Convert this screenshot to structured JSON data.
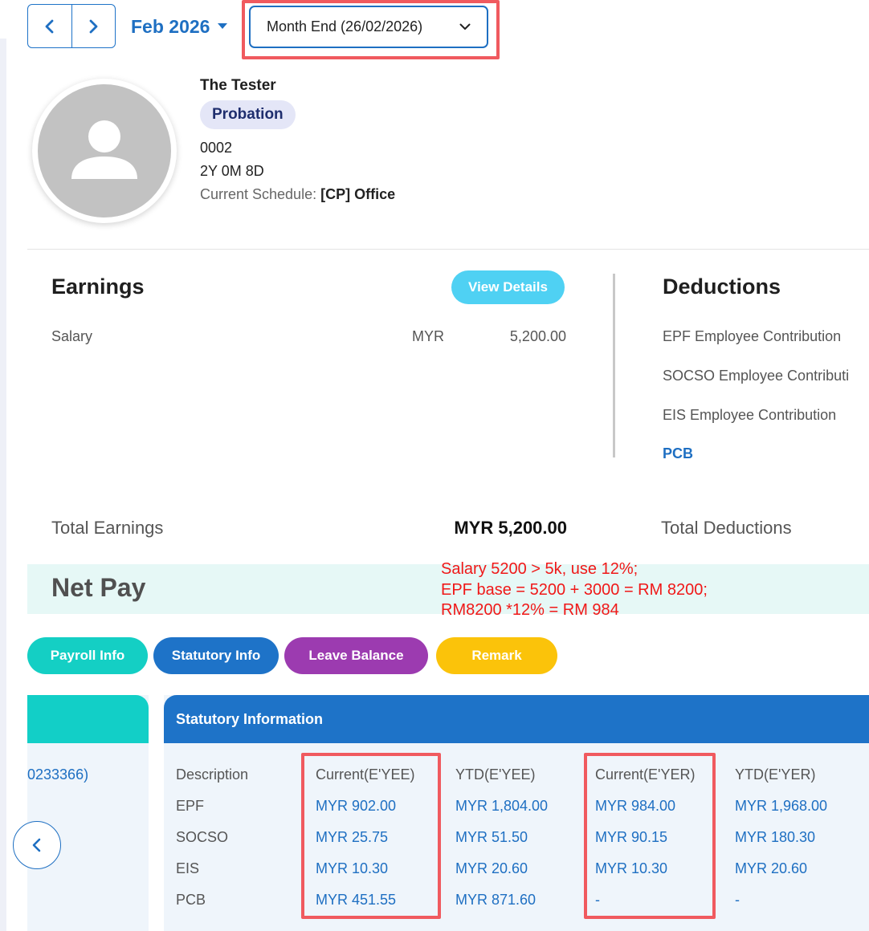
{
  "nav": {
    "month": "Feb 2026",
    "period": "Month End (26/02/2026)"
  },
  "profile": {
    "name": "The Tester",
    "status": "Probation",
    "employee_no": "0002",
    "tenure": "2Y 0M 8D",
    "schedule_label": "Current Schedule:",
    "schedule_value": "[CP] Office"
  },
  "earnings": {
    "title": "Earnings",
    "view_details": "View Details",
    "items": [
      {
        "label": "Salary",
        "currency": "MYR",
        "amount": "5,200.00"
      }
    ],
    "total_label": "Total Earnings",
    "total_value": "MYR 5,200.00"
  },
  "deductions": {
    "title": "Deductions",
    "items": [
      "EPF Employee Contribution",
      "SOCSO Employee Contributi",
      "EIS Employee Contribution",
      "PCB"
    ],
    "total_label": "Total Deductions"
  },
  "netpay": {
    "label": "Net Pay",
    "annotation": [
      "Salary 5200 > 5k, use 12%;",
      "EPF base = 5200 + 3000 = RM 8200;",
      "RM8200 *12% = RM 984"
    ]
  },
  "tabs": [
    {
      "label": "Payroll Info",
      "color": "#14cfc4"
    },
    {
      "label": "Statutory Info",
      "color": "#1e73c8"
    },
    {
      "label": "Leave Balance",
      "color": "#9c3bb0"
    },
    {
      "label": "Remark",
      "color": "#fbc30a"
    }
  ],
  "left_card": {
    "text": "0233366)"
  },
  "statutory": {
    "title": "Statutory Information",
    "headers": [
      "Description",
      "Current(E'YEE)",
      "YTD(E'YEE)",
      "Current(E'YER)",
      "YTD(E'YER)"
    ],
    "rows": [
      [
        "EPF",
        "MYR 902.00",
        "MYR 1,804.00",
        "MYR 984.00",
        "MYR 1,968.00"
      ],
      [
        "SOCSO",
        "MYR 25.75",
        "MYR 51.50",
        "MYR 90.15",
        "MYR 180.30"
      ],
      [
        "EIS",
        "MYR 10.30",
        "MYR 20.60",
        "MYR 10.30",
        "MYR 20.60"
      ],
      [
        "PCB",
        "MYR 451.55",
        "MYR 871.60",
        "-",
        "-"
      ]
    ]
  },
  "colors": {
    "primary": "#1e73c8",
    "highlight": "#f05a5f",
    "annotation": "#f01818"
  }
}
